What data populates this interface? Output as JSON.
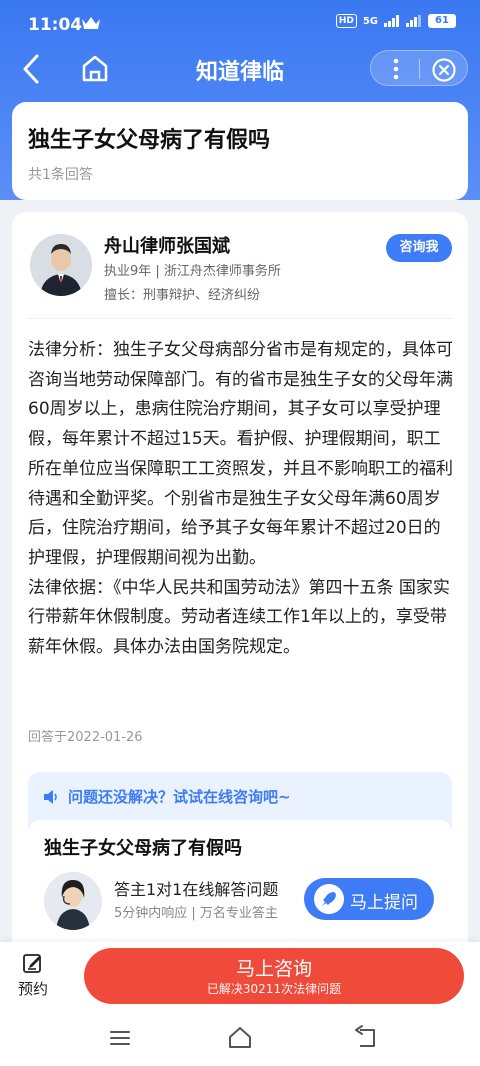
{
  "status": {
    "time": "11:04",
    "network": "5G",
    "hd": "HD",
    "battery": "61"
  },
  "nav": {
    "title": "知道律临"
  },
  "question": {
    "title": "独生子女父母病了有假吗",
    "answer_count": "共1条回答"
  },
  "lawyer": {
    "name": "舟山律师张国斌",
    "meta": "执业9年 | 浙江舟杰律师事务所",
    "skill": "擅长：刑事辩护、经济纠纷",
    "consult_label": "咨询我"
  },
  "answer": {
    "analysis": "法律分析：独生子女父母病部分省市是有规定的，具体可咨询当地劳动保障部门。有的省市是独生子女的父母年满60周岁以上，患病住院治疗期间，其子女可以享受护理假，每年累计不超过15天。看护假、护理假期间，职工所在单位应当保障职工工资照发，并且不影响职工的福利待遇和全勤评奖。个别省市是独生子女父母年满60周岁后，住院治疗期间，给予其子女每年累计不超过20日的护理假，护理假期间视为出勤。",
    "basis": "法律依据：《中华人民共和国劳动法》第四十五条 国家实行带薪年休假制度。劳动者连续工作1年以上的，享受带薪年休假。具体办法由国务院规定。",
    "date": "回答于2022-01-26"
  },
  "promo": {
    "heading": "问题还没解决？试试在线咨询吧~",
    "title": "独生子女父母病了有假吗",
    "line1": "答主1对1在线解答问题",
    "line2": "5分钟内响应 | 万名专业答主",
    "ask_label": "马上提问"
  },
  "bottom": {
    "reserve_label": "预约",
    "cta_main": "马上咨询",
    "cta_sub": "已解决30211次法律问题"
  },
  "colors": {
    "brand_blue": "#3d7cf6",
    "cta_red": "#f04b3a"
  }
}
